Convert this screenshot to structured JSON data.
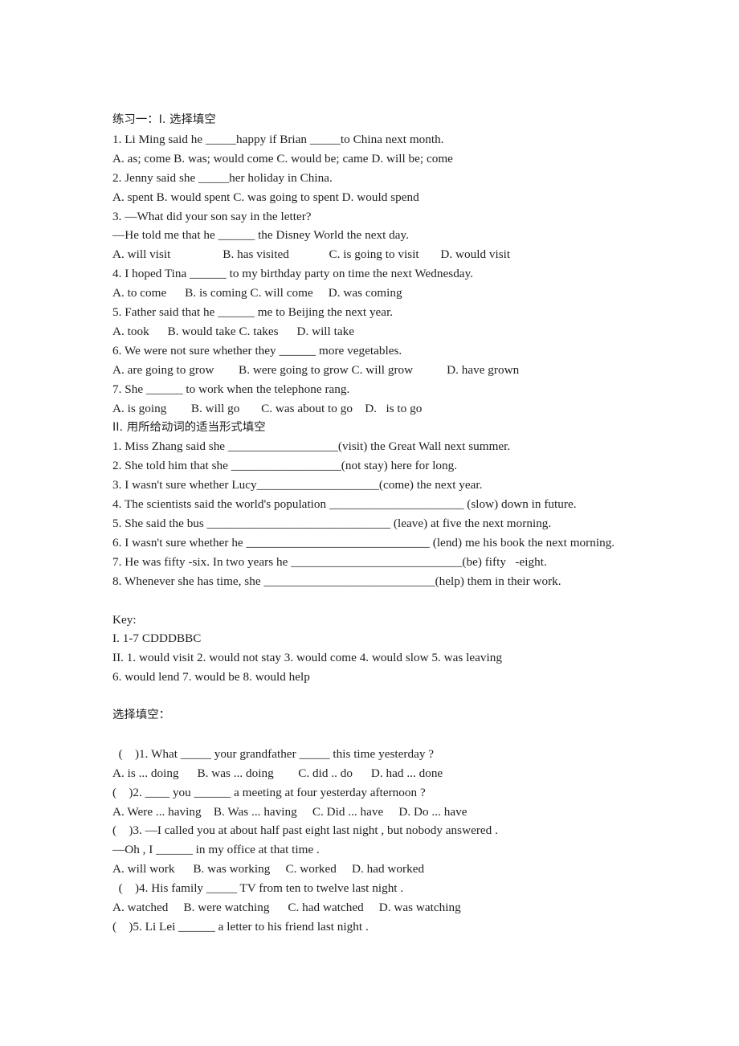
{
  "document": {
    "background_color": "#ffffff",
    "text_color": "#1f1f1f",
    "exercise1": {
      "heading": "练习一：I. 选择填空",
      "section2_heading": "II. 用所给动词的适当形式填空",
      "part1_lines": [
        "1. Li Ming said he _____happy if Brian _____to China next month.",
        "A. as; come B. was; would come C. would be; came D. will be; come",
        "2. Jenny said she _____her holiday in China.",
        "A. spent B. would spent C. was going to spent D. would spend",
        "3. —What did your son say in the letter?",
        "—He told me that he ______ the Disney World the next day.",
        "A. will visit                 B. has visited             C. is going to visit       D. would visit",
        "4. I hoped Tina ______ to my birthday party on time the next Wednesday.",
        "A. to come      B. is coming C. will come     D. was coming",
        "5. Father said that he ______ me to Beijing the next year.",
        "A. took      B. would take C. takes      D. will take",
        "6. We were not sure whether they ______ more vegetables.",
        "A. are going to grow        B. were going to grow C. will grow           D. have grown",
        "7. She ______ to work when the telephone rang.",
        "A. is going        B. will go       C. was about to go    D.   is to go"
      ],
      "part2_lines": [
        "1. Miss Zhang said she __________________(visit) the Great Wall next summer.",
        "2. She told him that she __________________(not stay) here for long.",
        "3. I wasn't sure whether Lucy____________________(come) the next year.",
        "4. The scientists said the world's population ______________________ (slow) down in future.",
        "5. She said the bus ______________________________ (leave) at five the next morning.",
        "6. I wasn't sure whether he ______________________________ (lend) me his book the next morning.",
        "7. He was fifty -six. In two years he ____________________________(be) fifty   -eight.",
        "8. Whenever she has time, she ____________________________(help) them in their work."
      ]
    },
    "key": {
      "label": "Key:",
      "lines": [
        "I. 1-7 CDDDBBC",
        "II. 1. would visit 2. would not stay 3. would come 4. would slow 5. was leaving",
        "6. would lend 7. would be 8. would help"
      ]
    },
    "exercise2": {
      "heading": "选择填空：",
      "lines": [
        "  (    )1. What _____ your grandfather _____ this time yesterday ?",
        "A. is ... doing      B. was ... doing        C. did .. do      D. had ... done",
        "(    )2. ____ you ______ a meeting at four yesterday afternoon ?",
        "A. Were ... having    B. Was ... having     C. Did ... have     D. Do ... have",
        "(    )3. —I called you at about half past eight last night , but nobody answered .",
        "—Oh , I ______ in my office at that time .",
        "A. will work      B. was working     C. worked     D. had worked",
        "  (    )4. His family _____ TV from ten to twelve last night .",
        "A. watched     B. were watching      C. had watched     D. was watching",
        "(    )5. Li Lei ______ a letter to his friend last night ."
      ]
    }
  }
}
